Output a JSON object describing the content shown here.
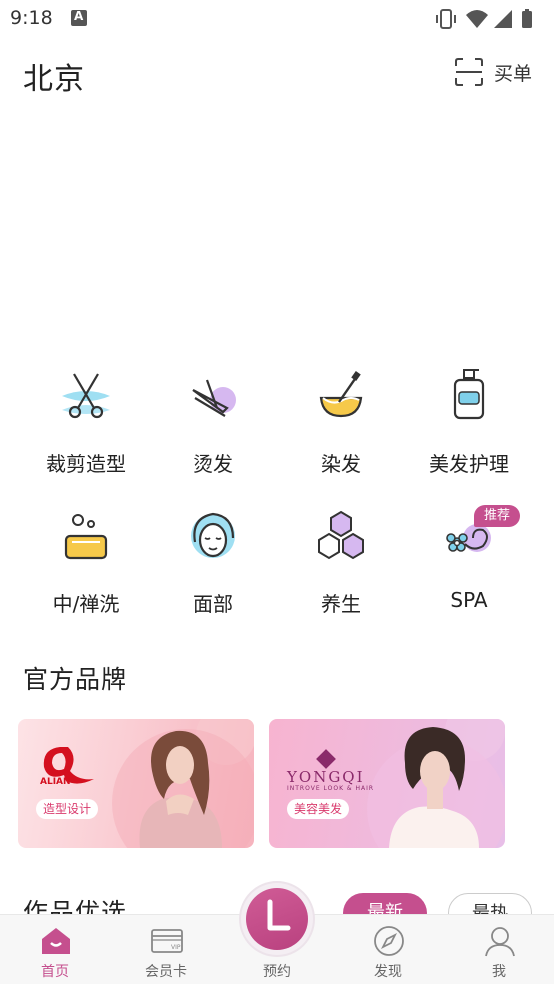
{
  "status_bar": {
    "time": "9:18"
  },
  "header": {
    "city": "北京",
    "scan_label": "买单"
  },
  "categories": [
    {
      "label": "裁剪造型",
      "icon": "scissors-icon"
    },
    {
      "label": "烫发",
      "icon": "curling-iron-icon"
    },
    {
      "label": "染发",
      "icon": "dye-bowl-icon"
    },
    {
      "label": "美发护理",
      "icon": "bottle-icon"
    },
    {
      "label": "中/禅洗",
      "icon": "soap-icon"
    },
    {
      "label": "面部",
      "icon": "face-icon"
    },
    {
      "label": "养生",
      "icon": "hexagon-icon"
    },
    {
      "label": "SPA",
      "icon": "spa-flower-icon",
      "badge": "推荐"
    }
  ],
  "brands": {
    "title": "官方品牌",
    "items": [
      {
        "logo_text": "ALIAN",
        "tag": "造型设计"
      },
      {
        "logo_text": "YONGQI",
        "logo_sub": "INTROVE LOOK & HAIR",
        "tag": "美容美发"
      }
    ]
  },
  "works": {
    "title": "作品优选",
    "tab_new": "最新",
    "tab_hot": "最热"
  },
  "tabbar": {
    "items": [
      {
        "label": "首页",
        "icon": "home-icon",
        "active": true
      },
      {
        "label": "会员卡",
        "icon": "vip-card-icon"
      },
      {
        "label": "预约",
        "icon": "clock-icon"
      },
      {
        "label": "发现",
        "icon": "compass-icon"
      },
      {
        "label": "我",
        "icon": "user-icon"
      }
    ]
  },
  "colors": {
    "accent": "#c54f8e",
    "icon_blue": "#7fd0ea",
    "icon_purple": "#c9a8ea",
    "icon_yellow": "#f6c94a"
  }
}
